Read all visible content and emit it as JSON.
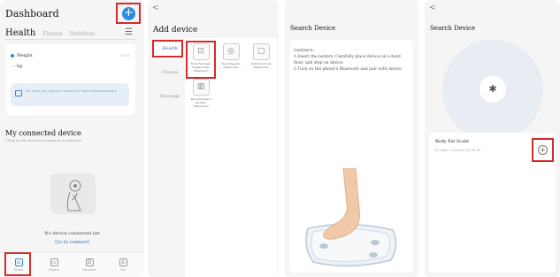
{
  "dashboard": {
    "title": "Dashboard",
    "add_button": "+",
    "tabs": {
      "active": "Health",
      "others": [
        "Fitness",
        "Nutrition"
      ]
    },
    "weight_label": "Weight",
    "weight_date": "07/11",
    "weight_value": "-- kg",
    "notice": "No data yet, please connect to take measurements",
    "connected_title": "My connected device",
    "connected_sub": "Click on the device to measure or exercise",
    "no_device": "No device connected yet",
    "go_connect": "Go to connect",
    "nav": [
      {
        "label": "Home",
        "icon": "home-icon",
        "glyph": "⌂"
      },
      {
        "label": "Device",
        "icon": "device-icon",
        "glyph": "▭"
      },
      {
        "label": "Discover",
        "icon": "discover-icon",
        "glyph": "☰"
      },
      {
        "label": "Me",
        "icon": "me-icon",
        "glyph": "♙"
      }
    ]
  },
  "add_device": {
    "back": "<",
    "title": "Add device",
    "categories": [
      "Health",
      "Fitness",
      "Massage"
    ],
    "devices": [
      {
        "label": "Body Fat Scale Weight Scale (Bluetooth)",
        "glyph": "⊡"
      },
      {
        "label": "Tape Measure (Bluetooth)",
        "glyph": "◎"
      },
      {
        "label": "Nutrition Scale (Bluetooth)",
        "glyph": "▢"
      },
      {
        "label": "Blood Pressure Monitor (Bluetooth)",
        "glyph": "▥"
      }
    ]
  },
  "search_guide": {
    "title": "Search Device",
    "guidance": "Guidance:\n1.Insert the battery. Carefully place device on a hard floor, and step on device\n2.Turn on the phone's Bluetooth and pair with device"
  },
  "search_result": {
    "back": "<",
    "title": "Search Device",
    "bluetooth_glyph": "✱",
    "device_name": "Body Fat Scale",
    "device_address": "Bt Addr: C8:B4:6C:2D:E6:1E",
    "add_glyph": "+"
  },
  "colors": {
    "accent": "#2d8be0",
    "highlight": "#d42b2b",
    "background": "#f5f5f5"
  }
}
